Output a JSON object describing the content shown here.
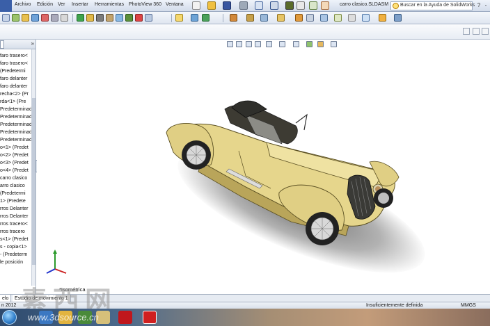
{
  "menubar": {
    "items": [
      "Archivo",
      "Edición",
      "Ver",
      "Insertar",
      "Herramientas",
      "PhotoView 360",
      "Ventana"
    ],
    "document_title": "carro clasico.SLDASM",
    "search_placeholder": "Buscar en la Ayuda de SolidWorks",
    "window_buttons": [
      "?",
      "-",
      "×"
    ]
  },
  "feature_tree": {
    "items": [
      "faro trasero<",
      "faro trasero<",
      "(Predetermi",
      "faro delanter",
      "faro delanter",
      "recha<2> (Pr",
      "rda<1> (Pre",
      "Predeterminad",
      "Predeterminad",
      "Predeterminad",
      "Predeterminad",
      "Predeterminad",
      "o<1> (Predet",
      "o<2> (Predet",
      "o<3> (Predet",
      "o<4> (Predet",
      "carro clasico",
      "arro clasico",
      "(Predetermi",
      "1> (Predete",
      "rros Delanter",
      "rros Delanter",
      "rros tracero<",
      "rros tracero",
      "s<1> (Predet",
      "s - copia<1>",
      "- (Predeterm",
      "le posición"
    ],
    "collapse_glyph": "»"
  },
  "viewport": {
    "view_label": "*Isométrica"
  },
  "bottom_tabs": [
    "elo",
    "Estudio de movimiento 1"
  ],
  "statusbar": {
    "left": "n 2012",
    "middle": "Insuficientemente definida",
    "right": "MMGS"
  },
  "watermark": {
    "chars": "素西网",
    "url": "www.3dsource.cn"
  },
  "colors": {
    "car_body": "#e6d68c",
    "car_body_shadow": "#b9a55a",
    "accent_blue": "#3a5fa8"
  }
}
